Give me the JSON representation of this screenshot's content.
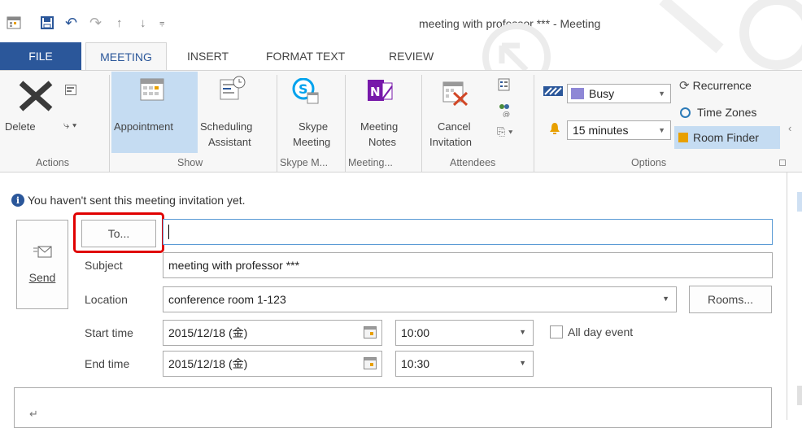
{
  "window": {
    "title": "meeting with professor *** - Meeting"
  },
  "tabs": {
    "file": "FILE",
    "meeting": "MEETING",
    "insert": "INSERT",
    "format_text": "FORMAT TEXT",
    "review": "REVIEW"
  },
  "ribbon": {
    "delete": "Delete",
    "appointment": "Appointment",
    "scheduling_line1": "Scheduling",
    "scheduling_line2": "Assistant",
    "skype_line1": "Skype",
    "skype_line2": "Meeting",
    "notes_line1": "Meeting",
    "notes_line2": "Notes",
    "cancel_line1": "Cancel",
    "cancel_line2": "Invitation",
    "show_as": "Busy",
    "reminder": "15 minutes",
    "recurrence": "Recurrence",
    "time_zones": "Time Zones",
    "room_finder": "Room Finder",
    "groups": {
      "actions": "Actions",
      "show": "Show",
      "skype": "Skype M...",
      "meeting": "Meeting...",
      "attendees": "Attendees",
      "options": "Options"
    }
  },
  "info_bar": "You haven't sent this meeting invitation yet.",
  "form": {
    "send": "Send",
    "to_button": "To...",
    "to_value": "",
    "subject_label": "Subject",
    "subject_value": "meeting with professor ***",
    "location_label": "Location",
    "location_value": "conference room 1-123",
    "rooms_button": "Rooms...",
    "start_label": "Start time",
    "start_date": "2015/12/18 (金)",
    "start_time": "10:00",
    "all_day": "All day event",
    "end_label": "End time",
    "end_date": "2015/12/18 (金)",
    "end_time": "10:30",
    "body_mark": "↵"
  },
  "colors": {
    "accent": "#2b579a",
    "highlight": "#c5dcf2",
    "callout": "#e00000"
  }
}
